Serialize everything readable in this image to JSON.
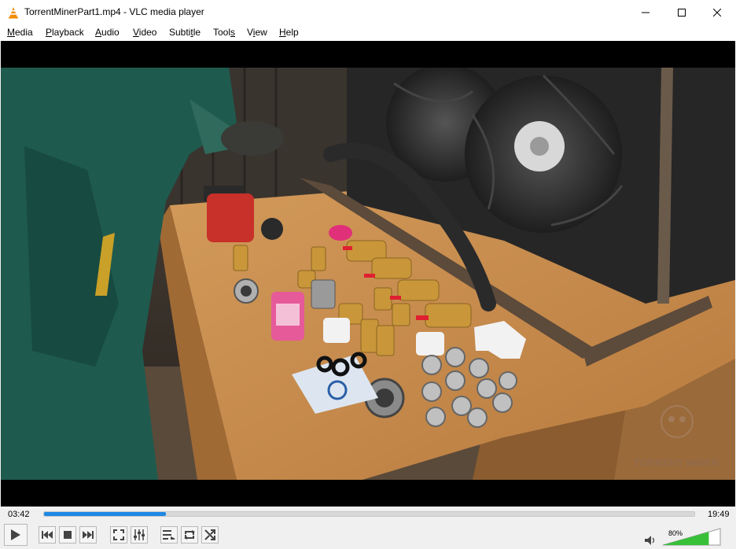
{
  "window": {
    "title": "TorrentMinerPart1.mp4 - VLC media player",
    "app_icon": "vlc-cone-icon"
  },
  "menu": [
    {
      "underline": "M",
      "rest": "edia"
    },
    {
      "underline": "P",
      "rest": "layback"
    },
    {
      "underline": "A",
      "rest": "udio"
    },
    {
      "underline": "V",
      "rest": "ideo"
    },
    {
      "underline": "",
      "pre": "Subti",
      "underline2": "t",
      "rest": "le"
    },
    {
      "underline": "",
      "pre": "Tool",
      "underline2": "s",
      "rest": ""
    },
    {
      "underline": "",
      "pre": "V",
      "underline2": "i",
      "rest": "ew"
    },
    {
      "underline": "H",
      "rest": "elp"
    }
  ],
  "video": {
    "watermark": "TORRENT MINER"
  },
  "playback": {
    "elapsed": "03:42",
    "total": "19:49",
    "progress_fraction": 0.187
  },
  "controls": {
    "play_icon": "play-icon",
    "prev_icon": "previous-icon",
    "stop_icon": "stop-icon",
    "next_icon": "next-icon",
    "fullscreen_icon": "fullscreen-icon",
    "extended_icon": "extended-settings-icon",
    "playlist_icon": "playlist-icon",
    "loop_icon": "loop-icon",
    "random_icon": "shuffle-icon"
  },
  "volume": {
    "label": "80%",
    "level_fraction": 0.8,
    "icon": "speaker-icon"
  }
}
